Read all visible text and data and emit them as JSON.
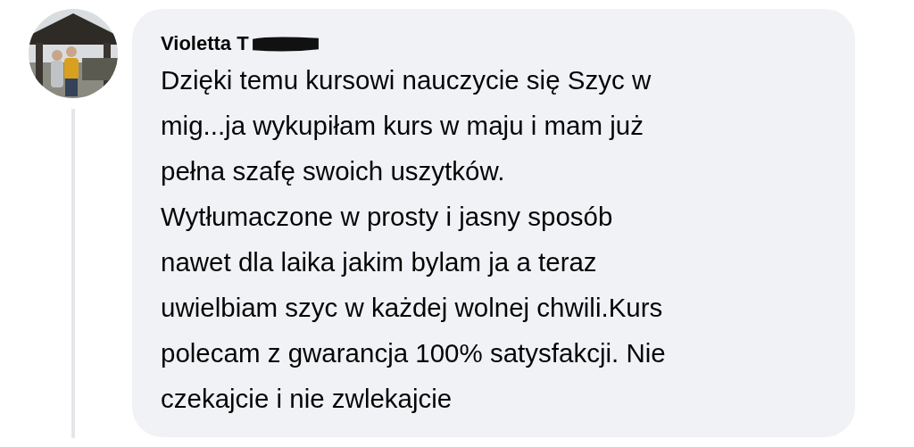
{
  "comment": {
    "author": "Violetta T",
    "author_redacted": true,
    "lines": [
      "Dzięki temu kursowi nauczycie się Szyc w",
      "mig...ja wykupiłam kurs w maju i mam już",
      "pełna szafę swoich uszytków.",
      "Wytłumaczone w prosty i jasny sposób",
      "nawet dla laika jakim bylam ja a teraz",
      "uwielbiam szyc w każdej wolnej chwili.Kurs",
      "polecam z gwarancja 100% satysfakcji. Nie",
      "czekajcie i nie zwlekajcie"
    ]
  }
}
